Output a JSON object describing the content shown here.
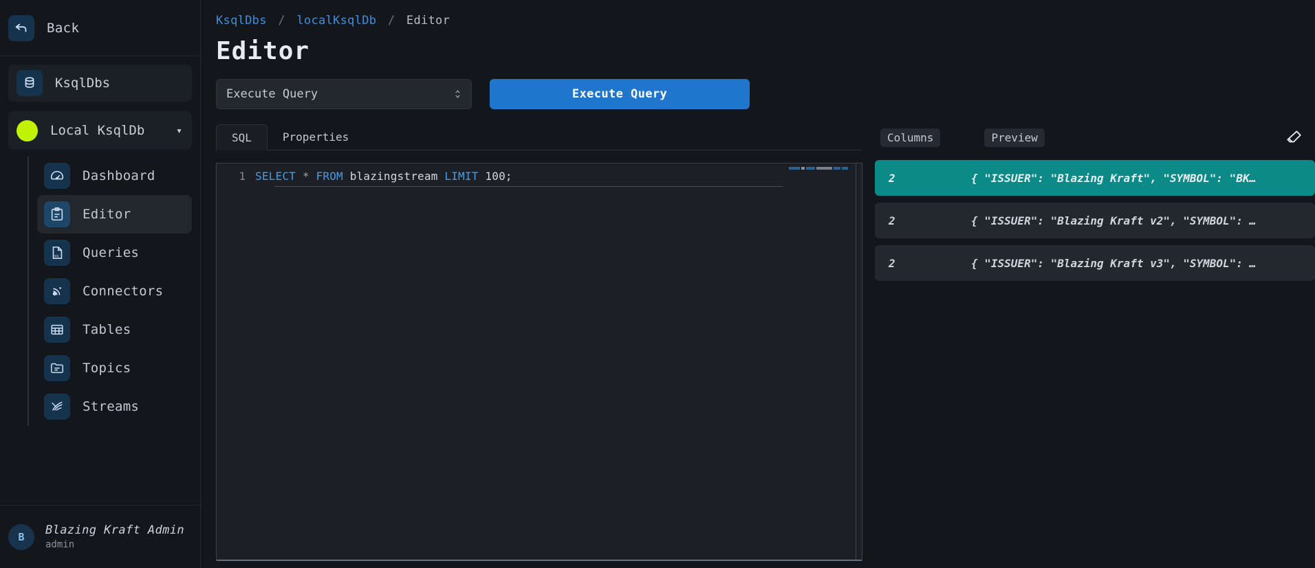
{
  "sidebar": {
    "back_label": "Back",
    "root_label": "KsqlDbs",
    "cluster_label": "Local KsqlDb",
    "cluster_status_color": "#bff204",
    "items": [
      {
        "label": "Dashboard",
        "icon": "gauge-icon",
        "active": false
      },
      {
        "label": "Editor",
        "icon": "clipboard-icon",
        "active": true
      },
      {
        "label": "Queries",
        "icon": "sql-file-icon",
        "active": false
      },
      {
        "label": "Connectors",
        "icon": "connectors-icon",
        "active": false
      },
      {
        "label": "Tables",
        "icon": "table-icon",
        "active": false
      },
      {
        "label": "Topics",
        "icon": "folder-icon",
        "active": false
      },
      {
        "label": "Streams",
        "icon": "streams-icon",
        "active": false
      }
    ],
    "user": {
      "initial": "B",
      "name": "Blazing Kraft Admin",
      "role": "admin"
    }
  },
  "header": {
    "breadcrumb": {
      "root": "KsqlDbs",
      "separator": "/",
      "cluster": "localKsqlDb",
      "current": "Editor"
    },
    "title": "Editor"
  },
  "toolbar": {
    "select_value": "Execute Query",
    "execute_label": "Execute Query",
    "accent_color": "#1f76cc"
  },
  "editor": {
    "tabs": [
      {
        "label": "SQL",
        "active": true
      },
      {
        "label": "Properties",
        "active": false
      }
    ],
    "line_number": "1",
    "sql": {
      "kw_select": "SELECT",
      "star": "*",
      "kw_from": "FROM",
      "table": "blazingstream",
      "kw_limit": "LIMIT",
      "limit_value": "100;"
    }
  },
  "results": {
    "columns_tab": "Columns",
    "preview_tab": "Preview",
    "clear_icon": "eraser-icon",
    "selected_color": "#0b8a87",
    "rows": [
      {
        "num": "2",
        "json": "{ \"ISSUER\": \"Blazing Kraft\", \"SYMBOL\": \"BK…",
        "selected": true
      },
      {
        "num": "2",
        "json": "{ \"ISSUER\": \"Blazing Kraft v2\", \"SYMBOL\": …",
        "selected": false
      },
      {
        "num": "2",
        "json": "{ \"ISSUER\": \"Blazing Kraft v3\", \"SYMBOL\": …",
        "selected": false
      }
    ]
  }
}
